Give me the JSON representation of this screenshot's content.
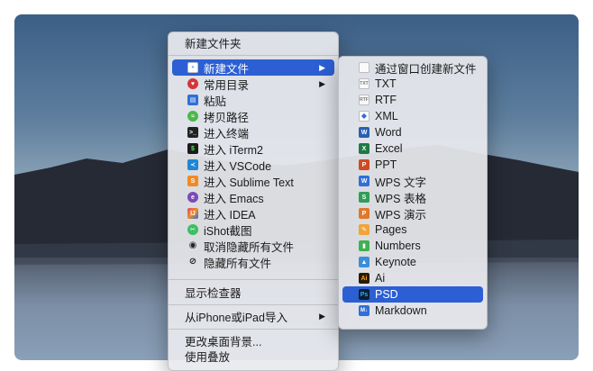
{
  "main_menu": {
    "items": [
      {
        "label": "新建文件夹"
      },
      {
        "label": "新建文件",
        "icon": "new-file-icon",
        "color": "#3a7bd5"
      },
      {
        "label": "常用目录",
        "icon": "heart-icon",
        "color": "#d6343a"
      },
      {
        "label": "粘贴",
        "icon": "paste-icon",
        "color": "#2f6fd6"
      },
      {
        "label": "拷贝路径",
        "icon": "path-icon",
        "color": "#4bb84b"
      },
      {
        "label": "进入终端",
        "icon": "terminal-icon",
        "color": "#222222"
      },
      {
        "label": "进入 iTerm2",
        "icon": "iterm2-icon",
        "color": "#1b1b1b"
      },
      {
        "label": "进入 VSCode",
        "icon": "vscode-icon",
        "color": "#1f86d6"
      },
      {
        "label": "进入 Sublime Text",
        "icon": "sublime-icon",
        "color": "#f08a24"
      },
      {
        "label": "进入 Emacs",
        "icon": "emacs-icon",
        "color": "#7b4bb7"
      },
      {
        "label": "进入 IDEA",
        "icon": "idea-icon",
        "color": "#e04b6e"
      },
      {
        "label": "iShot截图",
        "icon": "ishot-icon",
        "color": "#3bbf62"
      },
      {
        "label": "取消隐藏所有文件",
        "icon": "eye-icon",
        "color": "#222222"
      },
      {
        "label": "隐藏所有文件",
        "icon": "eye-slash-icon",
        "color": "#222222"
      },
      {
        "label": "显示检查器"
      },
      {
        "label": "从iPhone或iPad导入"
      },
      {
        "label": "更改桌面背景..."
      },
      {
        "label": "使用叠放"
      }
    ],
    "arrow": "▶"
  },
  "sub_menu": {
    "items": [
      {
        "label": "通过窗口创建新文件",
        "icon": "blank-doc-icon"
      },
      {
        "label": "TXT",
        "icon": "txt-doc-icon"
      },
      {
        "label": "RTF",
        "icon": "rtf-doc-icon"
      },
      {
        "label": "XML",
        "icon": "xml-doc-icon"
      },
      {
        "label": "Word",
        "icon": "word-icon",
        "color": "#2b5fb4",
        "glyph": "W"
      },
      {
        "label": "Excel",
        "icon": "excel-icon",
        "color": "#1f7a44",
        "glyph": "X"
      },
      {
        "label": "PPT",
        "icon": "ppt-icon",
        "color": "#d04a23",
        "glyph": "P"
      },
      {
        "label": "WPS 文字",
        "icon": "wps-writer-icon",
        "color": "#2f6fd6",
        "glyph": "W"
      },
      {
        "label": "WPS 表格",
        "icon": "wps-sheet-icon",
        "color": "#2f9e58",
        "glyph": "S"
      },
      {
        "label": "WPS 演示",
        "icon": "wps-present-icon",
        "color": "#e0782a",
        "glyph": "P"
      },
      {
        "label": "Pages",
        "icon": "pages-icon",
        "color": "#f2a33a",
        "glyph": "✎"
      },
      {
        "label": "Numbers",
        "icon": "numbers-icon",
        "color": "#3db24f",
        "glyph": "▮"
      },
      {
        "label": "Keynote",
        "icon": "keynote-icon",
        "color": "#3a8fd9",
        "glyph": "▲"
      },
      {
        "label": "Ai",
        "icon": "illustrator-icon",
        "color": "#2a1a05",
        "glyph": "Ai"
      },
      {
        "label": "PSD",
        "icon": "photoshop-icon",
        "color": "#0a1f33",
        "glyph": "Ps"
      },
      {
        "label": "Markdown",
        "icon": "markdown-icon",
        "color": "#2f6fd6",
        "glyph": "M↓"
      }
    ]
  }
}
